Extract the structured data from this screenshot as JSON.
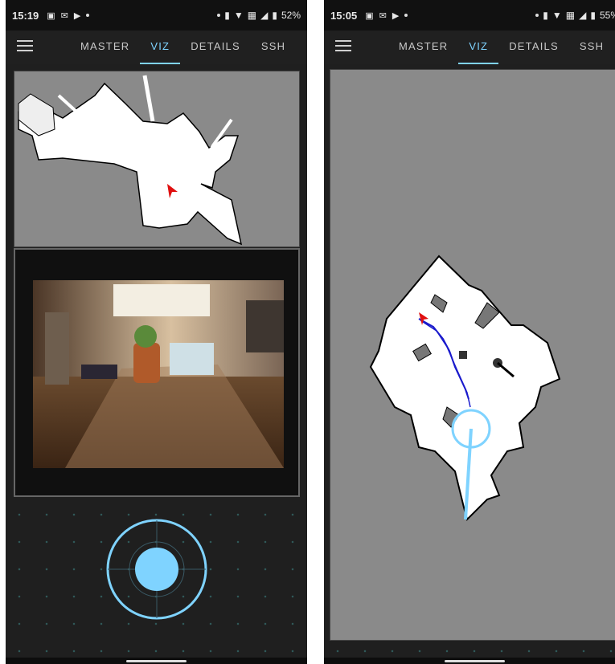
{
  "screens": [
    {
      "status": {
        "time": "15:19",
        "battery": "52%"
      },
      "menu_icon": "hamburger-menu-icon",
      "tabs": [
        {
          "label": "MASTER"
        },
        {
          "label": "VIZ"
        },
        {
          "label": "DETAILS"
        },
        {
          "label": "SSH"
        }
      ],
      "active_tab": 1
    },
    {
      "status": {
        "time": "15:05",
        "battery": "55%"
      },
      "menu_icon": "hamburger-menu-icon",
      "tabs": [
        {
          "label": "MASTER"
        },
        {
          "label": "VIZ"
        },
        {
          "label": "DETAILS"
        },
        {
          "label": "SSH"
        }
      ],
      "active_tab": 1
    }
  ],
  "colors": {
    "accent": "#7fd3ff",
    "robot_marker": "#e01010",
    "path_trail": "#1a1acc",
    "map_free": "#ffffff",
    "map_unknown": "#8a8a8a",
    "map_wall": "#000000"
  }
}
